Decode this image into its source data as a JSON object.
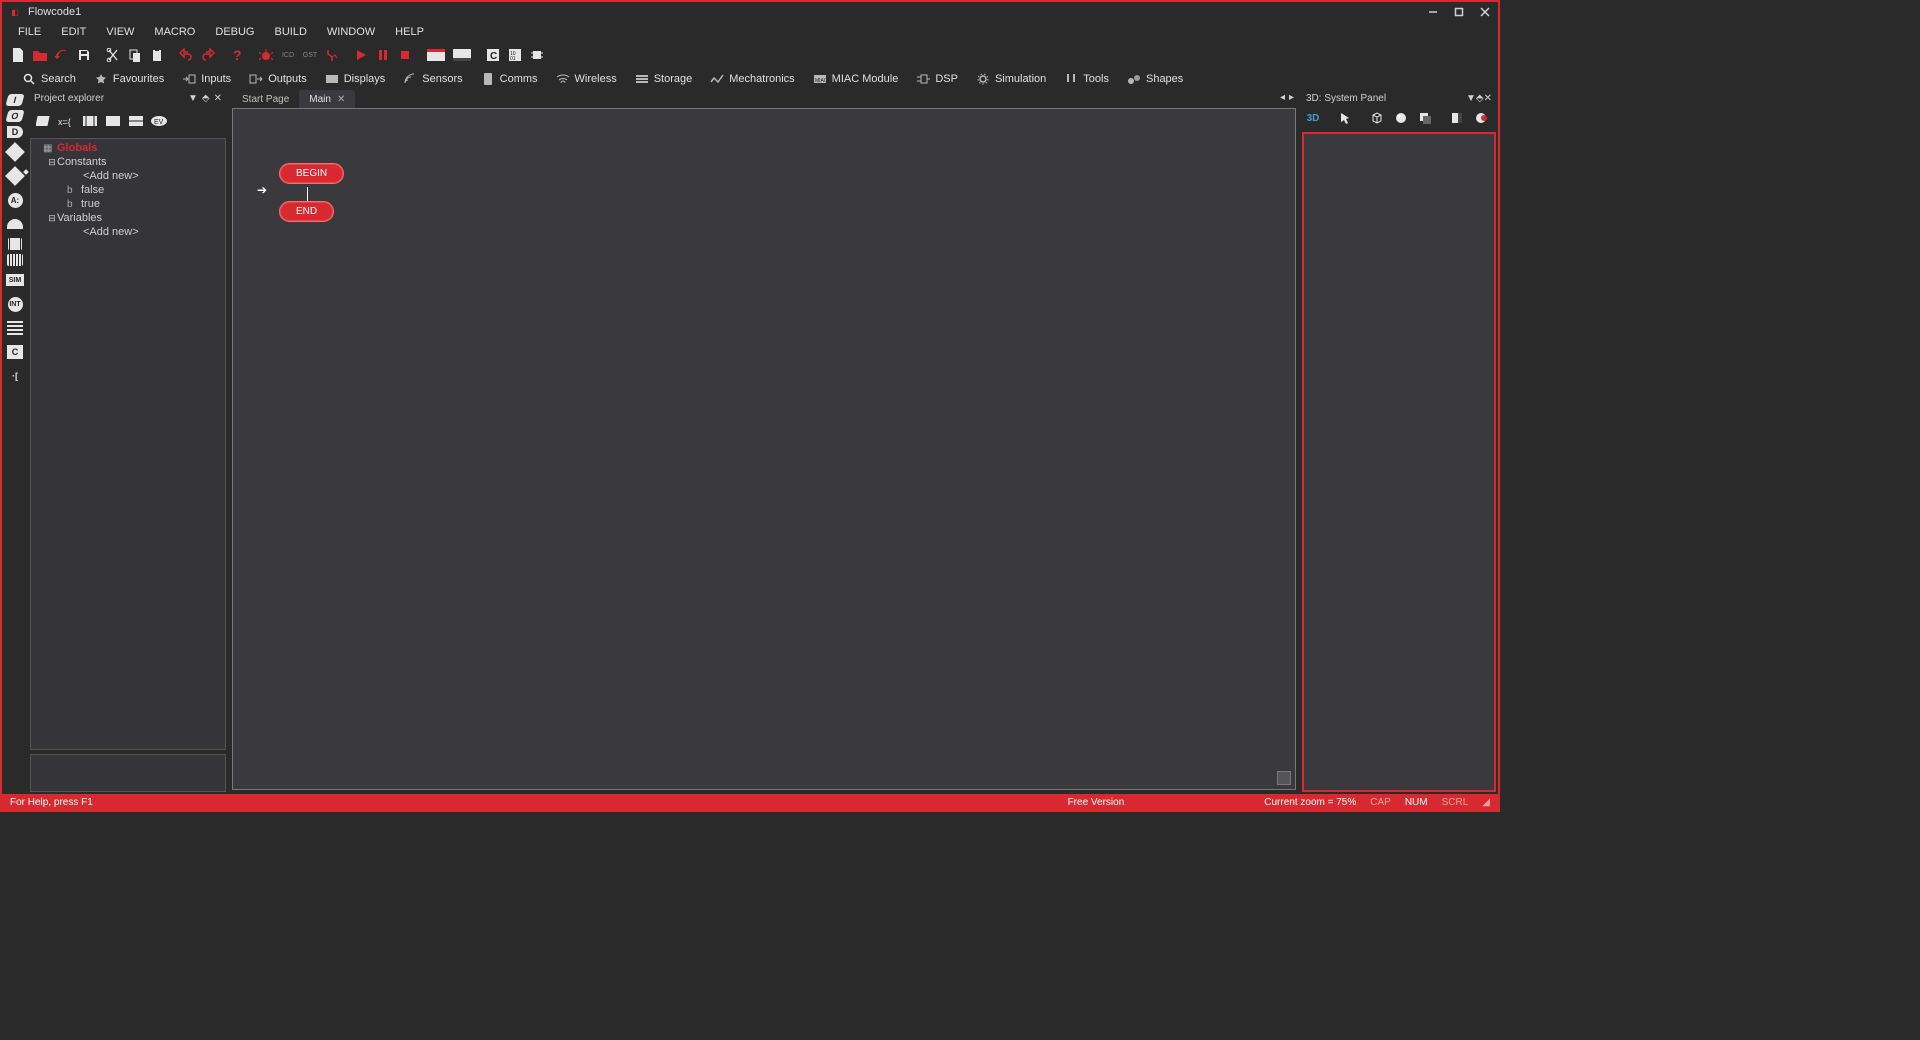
{
  "title": "Flowcode1",
  "menu": [
    "FILE",
    "EDIT",
    "VIEW",
    "MACRO",
    "DEBUG",
    "BUILD",
    "WINDOW",
    "HELP"
  ],
  "categories": [
    "Search",
    "Favourites",
    "Inputs",
    "Outputs",
    "Displays",
    "Sensors",
    "Comms",
    "Wireless",
    "Storage",
    "Mechatronics",
    "MIAC Module",
    "DSP",
    "Simulation",
    "Tools",
    "Shapes"
  ],
  "explorer": {
    "title": "Project explorer",
    "root": "Globals",
    "nodes": {
      "constants": "Constants",
      "addnew1": "<Add new>",
      "false": "false",
      "true": "true",
      "variables": "Variables",
      "addnew2": "<Add new>"
    }
  },
  "tabs": {
    "start": "Start Page",
    "main": "Main"
  },
  "flow": {
    "begin": "BEGIN",
    "end": "END"
  },
  "rpanel": {
    "title": "3D: System Panel",
    "mode": "3D"
  },
  "status": {
    "help": "For Help, press F1",
    "version": "Free Version",
    "zoom": "Current zoom = 75%",
    "cap": "CAP",
    "num": "NUM",
    "scrl": "SCRL"
  }
}
